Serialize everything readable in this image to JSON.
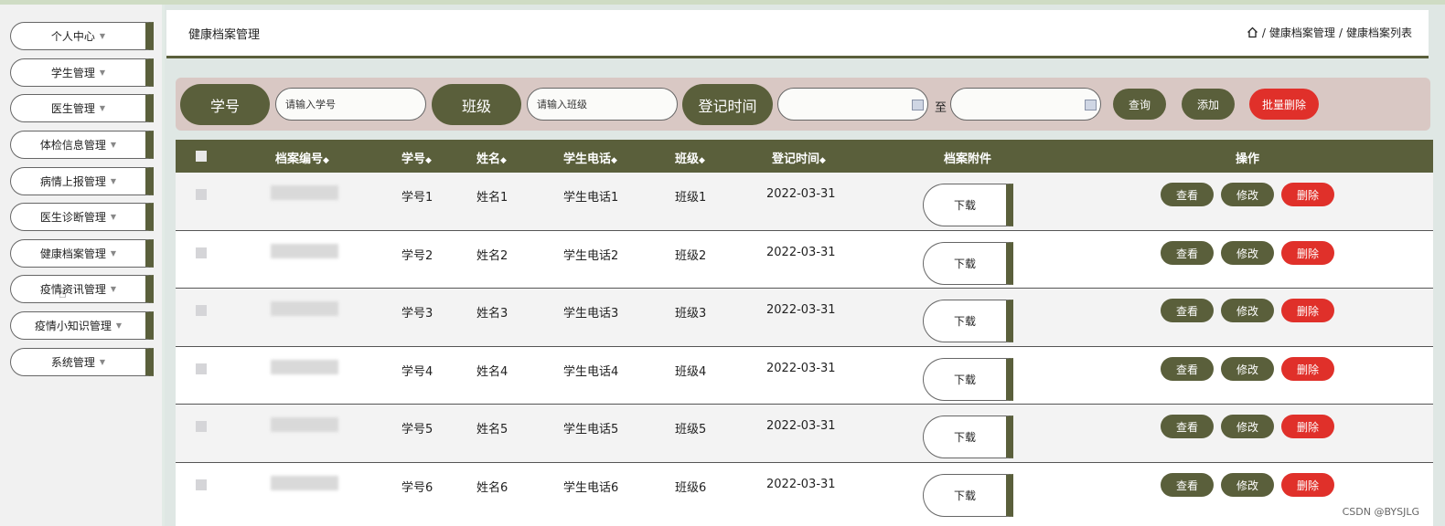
{
  "sidebar": {
    "items": [
      {
        "label": "个人中心"
      },
      {
        "label": "学生管理"
      },
      {
        "label": "医生管理"
      },
      {
        "label": "体检信息管理"
      },
      {
        "label": "病情上报管理"
      },
      {
        "label": "医生诊断管理"
      },
      {
        "label": "健康档案管理"
      },
      {
        "label": "疫情资讯管理"
      },
      {
        "label": "疫情小知识管理"
      },
      {
        "label": "系统管理"
      }
    ]
  },
  "header": {
    "title": "健康档案管理",
    "breadcrumb": [
      "健康档案管理",
      "健康档案列表"
    ],
    "separator": "/"
  },
  "search": {
    "student_no_label": "学号",
    "student_no_placeholder": "请输入学号",
    "class_label": "班级",
    "class_placeholder": "请输入班级",
    "date_label": "登记时间",
    "to_label": "至",
    "query_button": "查询",
    "add_button": "添加",
    "batch_delete_button": "批量删除"
  },
  "table": {
    "headers": {
      "archive_no": "档案编号",
      "student_no": "学号",
      "name": "姓名",
      "phone": "学生电话",
      "class": "班级",
      "reg_time": "登记时间",
      "attachment": "档案附件",
      "actions": "操作"
    },
    "sort_glyph": "◆",
    "download_label": "下载",
    "view_label": "查看",
    "edit_label": "修改",
    "delete_label": "删除",
    "rows": [
      {
        "student_no": "学号1",
        "name": "姓名1",
        "phone": "学生电话1",
        "class": "班级1",
        "reg_time": "2022-03-31"
      },
      {
        "student_no": "学号2",
        "name": "姓名2",
        "phone": "学生电话2",
        "class": "班级2",
        "reg_time": "2022-03-31"
      },
      {
        "student_no": "学号3",
        "name": "姓名3",
        "phone": "学生电话3",
        "class": "班级3",
        "reg_time": "2022-03-31"
      },
      {
        "student_no": "学号4",
        "name": "姓名4",
        "phone": "学生电话4",
        "class": "班级4",
        "reg_time": "2022-03-31"
      },
      {
        "student_no": "学号5",
        "name": "姓名5",
        "phone": "学生电话5",
        "class": "班级5",
        "reg_time": "2022-03-31"
      },
      {
        "student_no": "学号6",
        "name": "姓名6",
        "phone": "学生电话6",
        "class": "班级6",
        "reg_time": "2022-03-31"
      }
    ]
  },
  "watermark": "CSDN @BYSJLG",
  "colors": {
    "accent": "#5a5f3b",
    "danger": "#e0302a",
    "search_bg": "#d9c8c4"
  }
}
